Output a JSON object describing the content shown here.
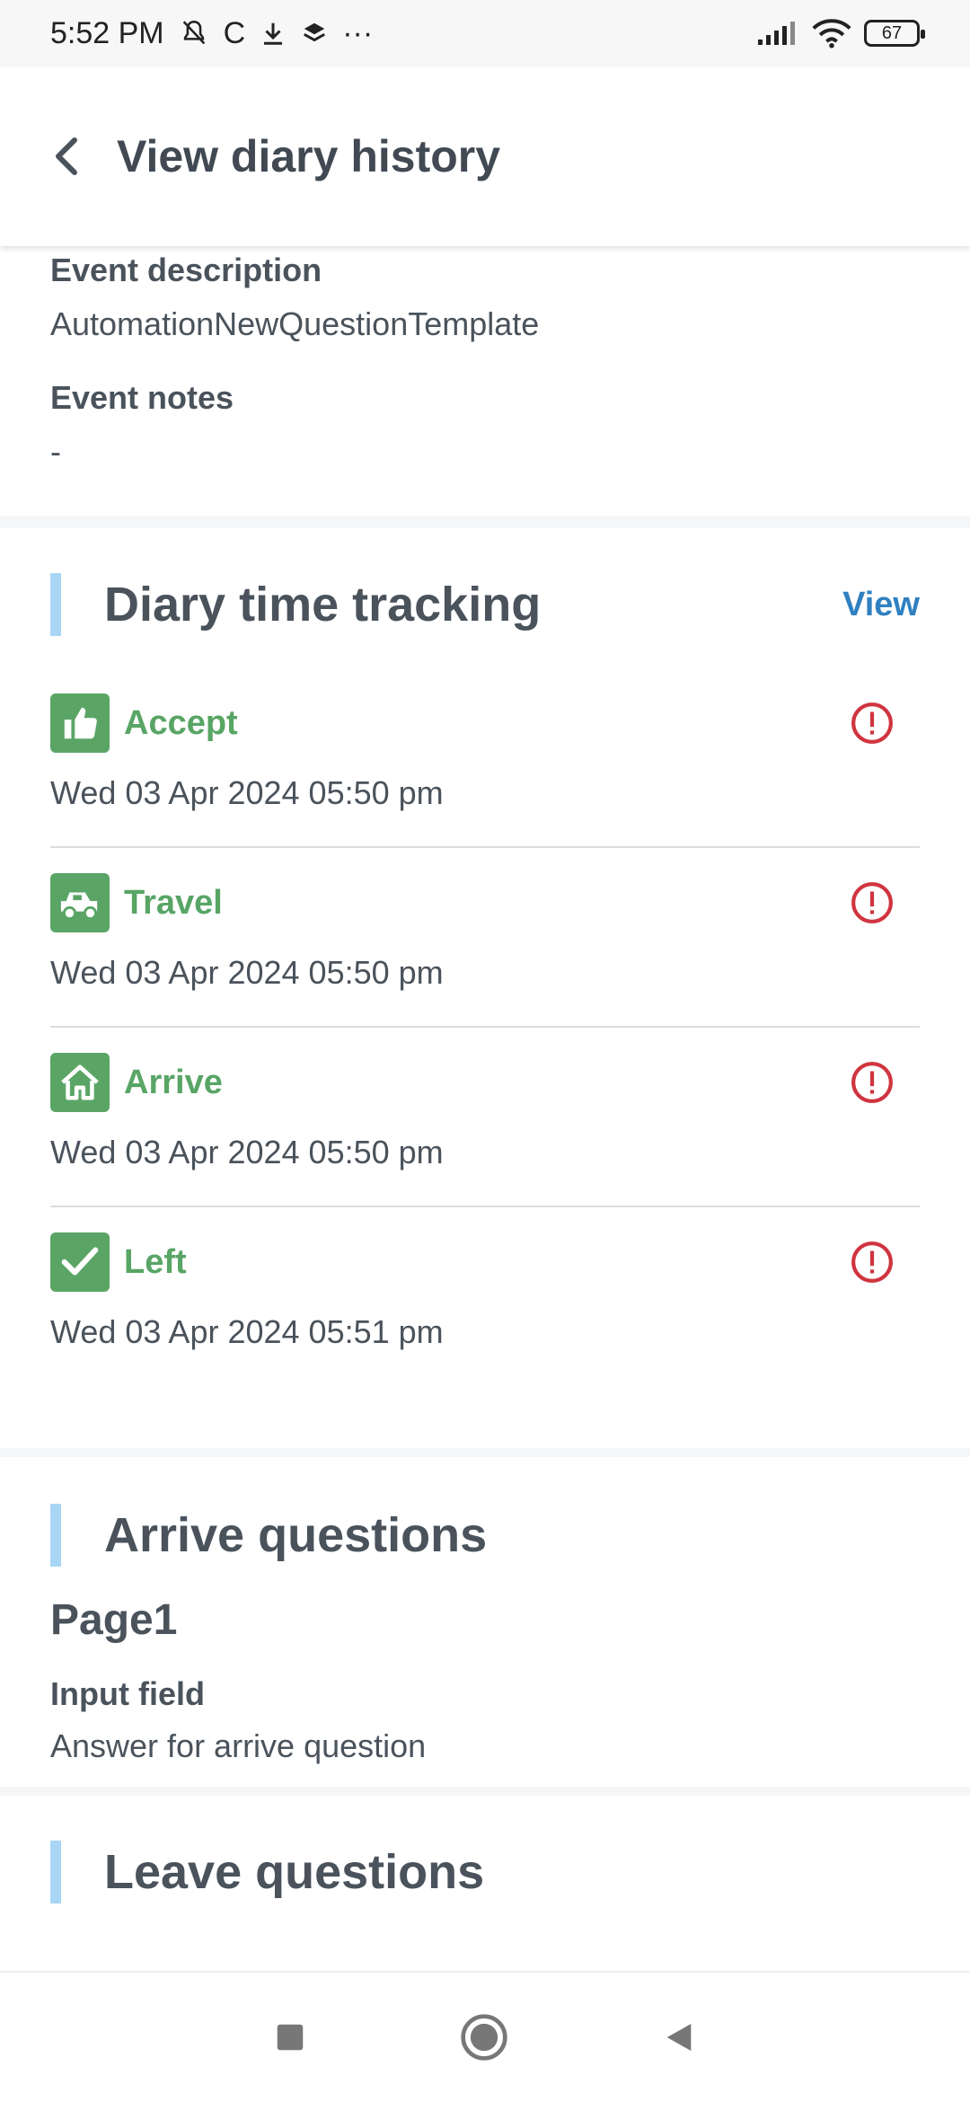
{
  "status_bar": {
    "time": "5:52 PM",
    "carrier_letter": "C",
    "more": "···",
    "battery": "67"
  },
  "header": {
    "title": "View diary history"
  },
  "event_info": {
    "description_label": "Event description",
    "description_value": "AutomationNewQuestionTemplate",
    "notes_label": "Event notes",
    "notes_value": "-"
  },
  "time_tracking": {
    "title": "Diary time tracking",
    "view_label": "View",
    "items": [
      {
        "label": "Accept",
        "time": "Wed 03 Apr 2024 05:50 pm",
        "icon": "thumbs-up-icon"
      },
      {
        "label": "Travel",
        "time": "Wed 03 Apr 2024 05:50 pm",
        "icon": "car-icon"
      },
      {
        "label": "Arrive",
        "time": "Wed 03 Apr 2024 05:50 pm",
        "icon": "home-icon"
      },
      {
        "label": "Left",
        "time": "Wed 03 Apr 2024 05:51 pm",
        "icon": "checkmark-icon"
      }
    ]
  },
  "arrive_questions": {
    "title": "Arrive questions",
    "page_title": "Page1",
    "field_label": "Input field",
    "field_value": "Answer for arrive question"
  },
  "leave_questions": {
    "title": "Leave questions"
  },
  "colors": {
    "accent_bar": "#a9d6f5",
    "status_green": "#5aa566",
    "alert_red": "#d0343f",
    "link_blue": "#2f80c0"
  }
}
